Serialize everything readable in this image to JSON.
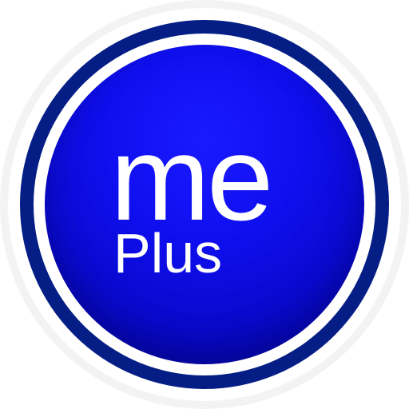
{
  "logo": {
    "line1": "me",
    "line2": "Plus"
  },
  "colors": {
    "core_blue": "#0f0ff0",
    "ring_navy": "#051e86",
    "text": "#ffffff",
    "background": "#ffffff"
  }
}
